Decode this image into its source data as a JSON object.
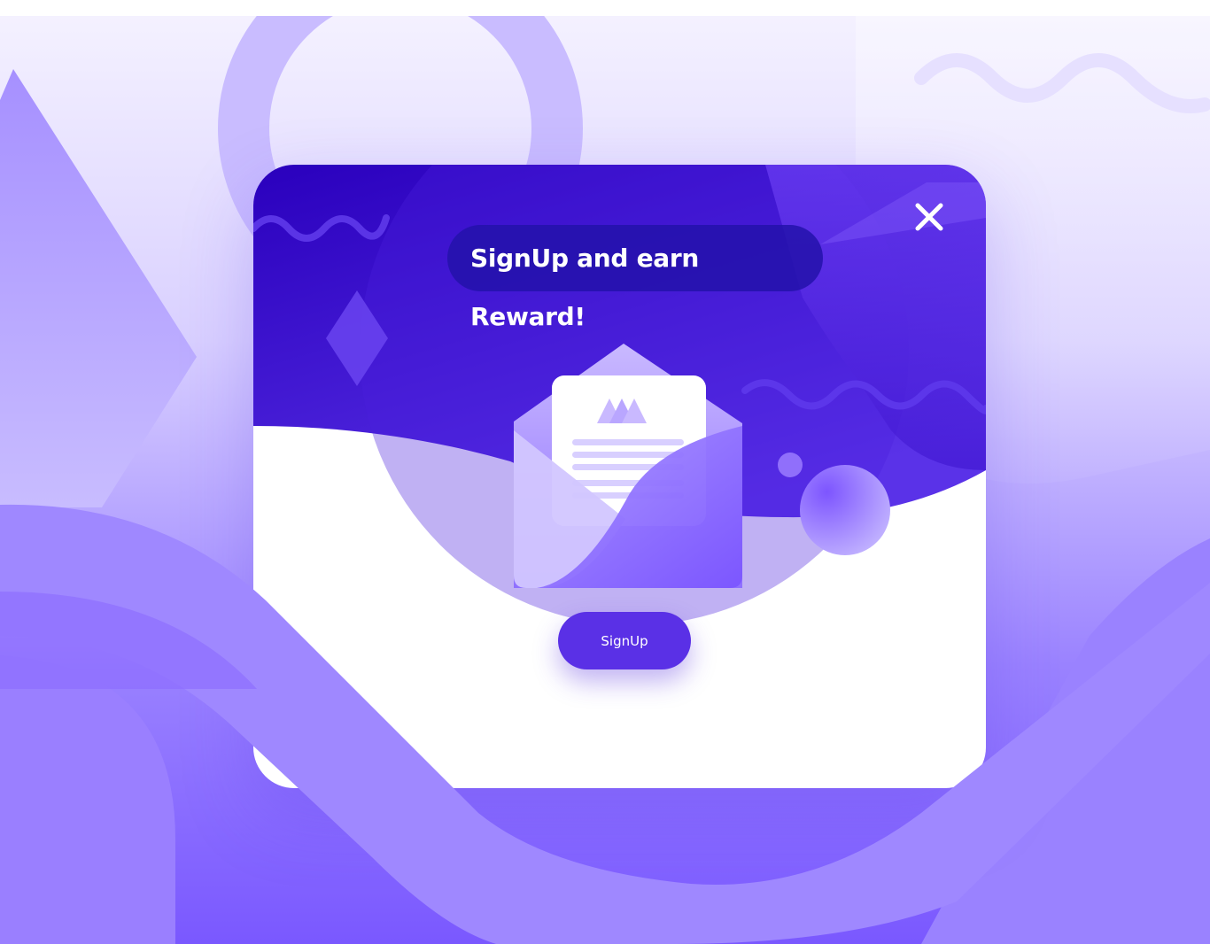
{
  "modal": {
    "title_line_1": "SignUp and earn",
    "title_line_2": "Reward!",
    "signup_label": "SignUp",
    "close_icon": "close-icon",
    "illustration": "envelope-with-letter-icon"
  },
  "colors": {
    "primary": "#5a30e6",
    "header_dark": "#2a00bd",
    "header_light": "#7a4cff",
    "lavender": "#b7a7ff",
    "white": "#ffffff"
  }
}
